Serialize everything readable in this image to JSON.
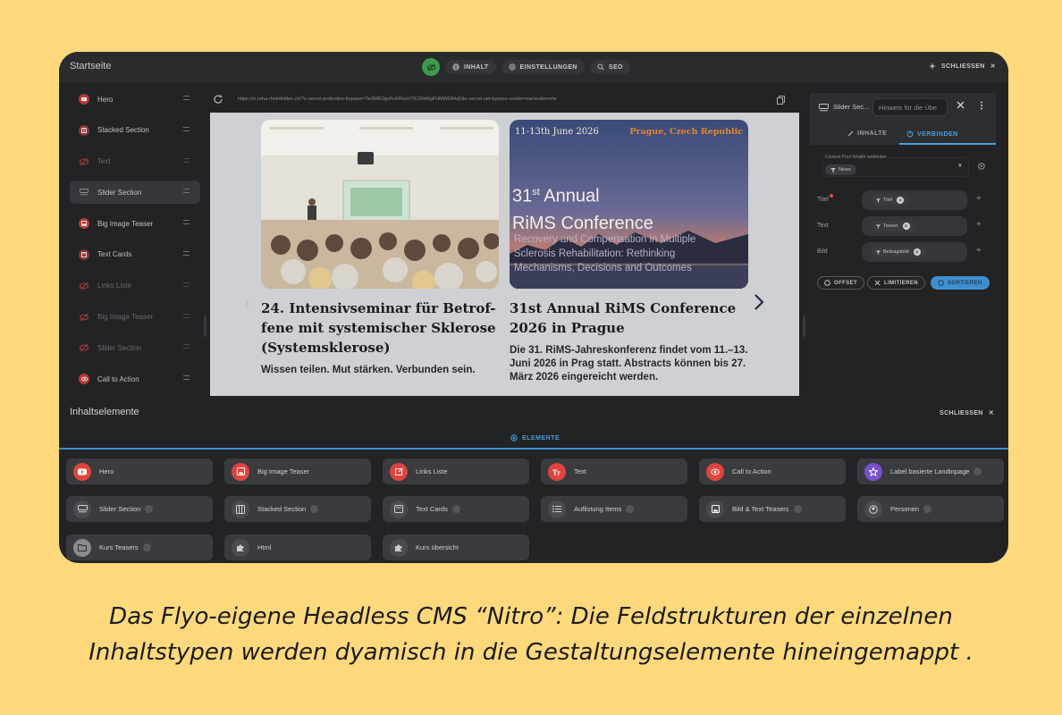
{
  "topbar": {
    "page_name": "Startseite",
    "tabs": [
      {
        "label": "INHALT",
        "icon": "globe-icon"
      },
      {
        "label": "EINSTELLUNGEN",
        "icon": "gear-icon"
      },
      {
        "label": "SEO",
        "icon": "search-icon"
      }
    ],
    "close_label": "SCHLIESSEN"
  },
  "sidebar": {
    "items": [
      {
        "label": "Hero",
        "visible": true
      },
      {
        "label": "Stacked Section",
        "visible": true
      },
      {
        "label": "Text",
        "visible": false
      },
      {
        "label": "Slider Section",
        "visible": true,
        "active": true
      },
      {
        "label": "Big Image Teaser",
        "visible": true
      },
      {
        "label": "Text Cards",
        "visible": true
      },
      {
        "label": "Links Liste",
        "visible": false
      },
      {
        "label": "Big Image Teaser",
        "visible": false
      },
      {
        "label": "Slider Section",
        "visible": false
      },
      {
        "label": "Call to Action",
        "visible": true
      }
    ]
  },
  "preview": {
    "url": "https://ci.reha-rheinfelden.ch/?x-vercel-protection-bypass=7ie3WE3gsFuKRzaVYE3XkMgFHMW684q5&x-vercel-set-bypass-cookie=samesitenone",
    "card1": {
      "title_lines": [
        "24. Intensivseminar für Betrof-",
        "fene mit systemischer Sklerose",
        "(Systemsklerose)"
      ],
      "text": "Wissen teilen. Mut stärken. Verbunden sein."
    },
    "card2": {
      "img_date": "11-13th June 2026",
      "img_location": "Prague, Czech Republic",
      "img_heading_prefix": "31",
      "img_heading_sup": "st",
      "img_heading_rest": " Annual",
      "img_heading_2": "RiMS Conference",
      "img_sub_lines": [
        "Recovery and Compensation in Multiple",
        "Sclerosis Rehabilitation: Rethinking",
        "Mechanisms, Decisions and Outcomes"
      ],
      "title_lines": [
        "31st Annual RiMS Conference",
        "2026 in Prague"
      ],
      "text_lines": [
        "Die 31. RiMS-Jahreskonferenz findet vom 11.–13.",
        "Juni 2026 in Prag statt. Abstracts können bis 27.",
        "März 2026 eingereicht werden."
      ]
    }
  },
  "panel": {
    "title": "Slider Sec...",
    "hint_placeholder": "Hinweis für die Übe",
    "tab_inhalte": "INHALTE",
    "tab_verbinden": "VERBINDEN",
    "pool_label": "Content Pool Inhalte verbinden",
    "pool_value": "News",
    "fields": [
      {
        "label": "Titel",
        "chip": "Titel",
        "required": true
      },
      {
        "label": "Text",
        "chip": "Teaser",
        "required": false
      },
      {
        "label": "Bild",
        "chip": "Beitragsbild",
        "required": false
      }
    ],
    "actions": {
      "offset": "OFFSET",
      "limit": "LIMITIEREN",
      "sort": "SORTIEREN"
    }
  },
  "bottom": {
    "title": "Inhaltselemente",
    "close_label": "SCHLIESSEN",
    "tab": "ELEMENTE",
    "elements": [
      {
        "label": "Hero",
        "color": "#e0443f",
        "icon": "play-icon",
        "badge": false
      },
      {
        "label": "Big Image Teaser",
        "color": "#e0443f",
        "icon": "image-icon",
        "badge": false
      },
      {
        "label": "Links Liste",
        "color": "#e0443f",
        "icon": "external-link-icon",
        "badge": false
      },
      {
        "label": "Text",
        "color": "#e0443f",
        "icon": "text-size-icon",
        "badge": false
      },
      {
        "label": "Call to Action",
        "color": "#e0443f",
        "icon": "eye-icon",
        "badge": false
      },
      {
        "label": "Label basierte Landinpage",
        "color": "#7a4fcf",
        "icon": "star-icon",
        "badge": true
      },
      {
        "label": "Slider Section",
        "color": "#4a4b4f",
        "icon": "slider-icon",
        "badge": true
      },
      {
        "label": "Stacked Section",
        "color": "#4a4b4f",
        "icon": "columns-icon",
        "badge": true
      },
      {
        "label": "Text Cards",
        "color": "#4a4b4f",
        "icon": "card-icon",
        "badge": true
      },
      {
        "label": "Auflistung Items",
        "color": "#4a4b4f",
        "icon": "list-icon",
        "badge": true
      },
      {
        "label": "Bild & Text Teasers",
        "color": "#4a4b4f",
        "icon": "image-icon",
        "badge": true
      },
      {
        "label": "Personen",
        "color": "#4a4b4f",
        "icon": "person-icon",
        "badge": true
      },
      {
        "label": "Kurs Teasers",
        "color": "#8a8b8e",
        "icon": "folder-icon",
        "badge": true
      },
      {
        "label": "Html",
        "color": "#4a4b4f",
        "icon": "puzzle-icon",
        "badge": false
      },
      {
        "label": "Kurs übersicht",
        "color": "#4a4b4f",
        "icon": "puzzle-icon",
        "badge": false
      }
    ]
  },
  "caption": {
    "line1": "Das Flyo-eigene Headless CMS “Nitro”: Die Feldstrukturen der einzelnen",
    "line2": "Inhaltstypen werden dyamisch in die Gestaltungselemente hineingemappt ."
  }
}
